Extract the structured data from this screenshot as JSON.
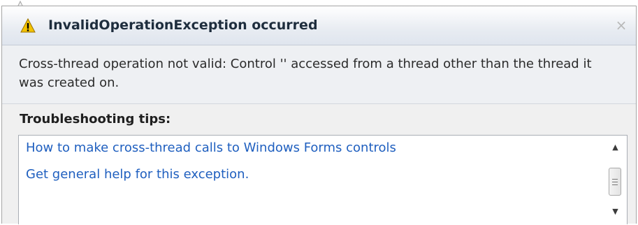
{
  "dialog": {
    "title": "InvalidOperationException occurred",
    "title_icon": "warning-triangle-icon",
    "close_glyph": "×",
    "message": "Cross-thread operation not valid: Control '' accessed from a thread other than the thread it was created on.",
    "tips_heading": "Troubleshooting tips:",
    "tips": [
      {
        "label": "How to make cross-thread calls to Windows Forms controls"
      },
      {
        "label": "Get general help for this exception."
      }
    ]
  },
  "scrollbar": {
    "up_glyph": "▲",
    "down_glyph": "▼"
  },
  "colors": {
    "link": "#1f5fbf",
    "warning_icon": "#f2c200"
  }
}
